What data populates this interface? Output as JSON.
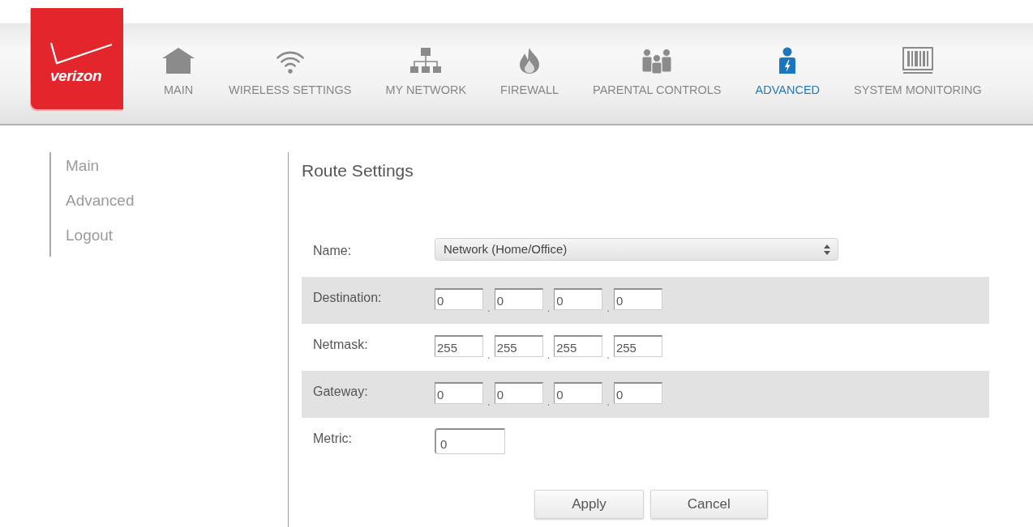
{
  "logo": {
    "text": "verizon"
  },
  "nav": [
    {
      "label": "MAIN",
      "selected": false
    },
    {
      "label": "WIRELESS SETTINGS",
      "selected": false
    },
    {
      "label": "MY NETWORK",
      "selected": false
    },
    {
      "label": "FIREWALL",
      "selected": false
    },
    {
      "label": "PARENTAL CONTROLS",
      "selected": false
    },
    {
      "label": "ADVANCED",
      "selected": true
    },
    {
      "label": "SYSTEM MONITORING",
      "selected": false
    }
  ],
  "sidebar": {
    "items": [
      {
        "label": "Main"
      },
      {
        "label": "Advanced"
      },
      {
        "label": "Logout"
      }
    ]
  },
  "route_settings": {
    "title": "Route Settings",
    "fields": [
      {
        "kind": "select",
        "label": "Name:",
        "value": "Network (Home/Office)"
      },
      {
        "kind": "ip",
        "label": "Destination:",
        "octets": [
          "0",
          "0",
          "0",
          "0"
        ],
        "separators": [
          ".",
          ".",
          "."
        ]
      },
      {
        "kind": "ip",
        "label": "Netmask:",
        "octets": [
          "255",
          "255",
          "255",
          "255"
        ],
        "separators": [
          ".",
          ".",
          "."
        ]
      },
      {
        "kind": "ip",
        "label": "Gateway:",
        "octets": [
          "0",
          "0",
          "0",
          "0"
        ],
        "separators": [
          ".",
          ".",
          "."
        ]
      },
      {
        "kind": "text",
        "label": "Metric:",
        "value": "0"
      }
    ],
    "buttons": [
      "Apply",
      "Cancel"
    ]
  }
}
